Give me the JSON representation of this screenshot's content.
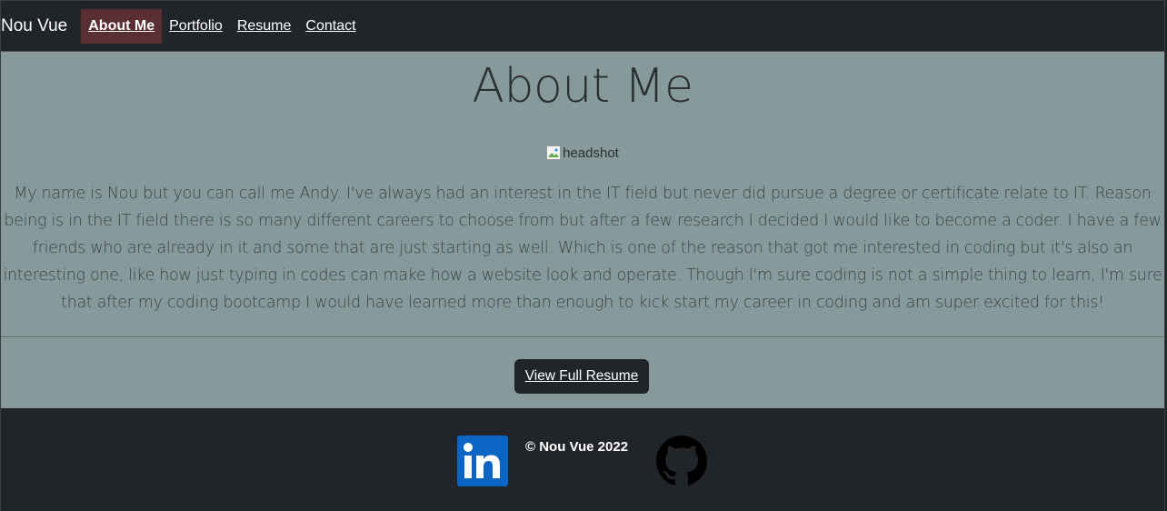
{
  "nav": {
    "brand": "Nou Vue",
    "items": [
      {
        "label": "About Me",
        "active": true
      },
      {
        "label": "Portfolio",
        "active": false
      },
      {
        "label": "Resume",
        "active": false
      },
      {
        "label": "Contact",
        "active": false
      }
    ]
  },
  "main": {
    "title": "About Me",
    "image_alt": "headshot",
    "bio": "My name is Nou but you can call me Andy. I've always had an interest in the IT field but never did pursue a degree or certificate relate to IT. Reason being is in the IT field there is so many different careers to choose from but after a few research I decided I would like to become a coder. I have a few friends who are already in it and some that are just starting as well. Which is one of the reason that got me interested in coding but it's also an interesting one, like how just typing in codes can make how a website look and operate. Though I'm sure coding is not a simple thing to learn, I'm sure that after my coding bootcamp I would have learned more than enough to kick start my career in coding and am super excited for this!",
    "resume_button": "View Full Resume"
  },
  "footer": {
    "copyright": "© Nou Vue 2022",
    "linkedin_icon": "linkedin-icon",
    "github_icon": "github-icon"
  },
  "colors": {
    "nav_bg": "#212529",
    "active_tab": "#5a2f33",
    "main_bg": "#869a9b",
    "linkedin_blue": "#0a66c2"
  }
}
